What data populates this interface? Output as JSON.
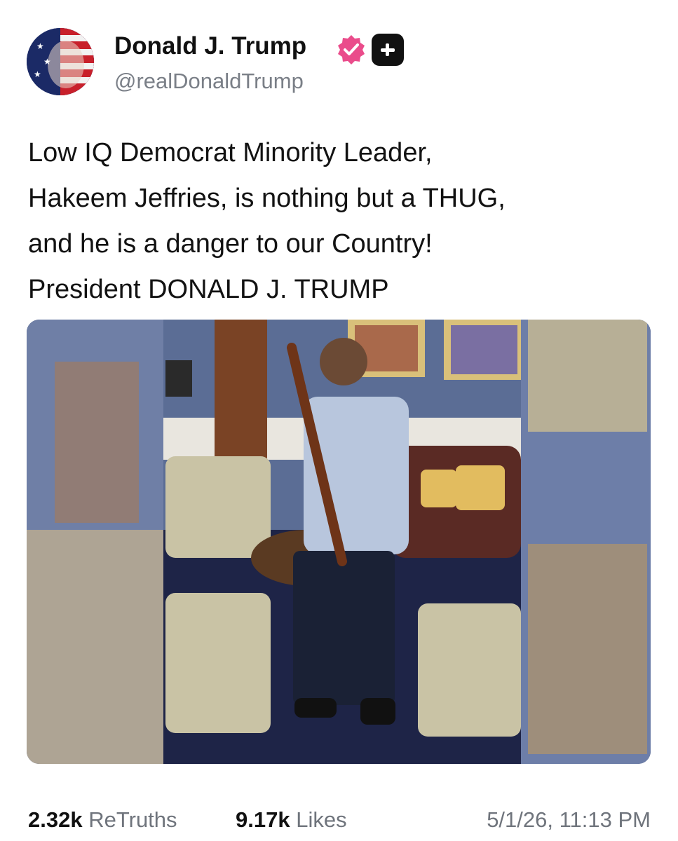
{
  "author": {
    "name": "Donald J. Trump",
    "handle": "@realDonaldTrump",
    "verified_color": "#ea4c8b"
  },
  "post": {
    "lines": [
      "Low IQ Democrat Minority Leader,",
      "Hakeem Jeffries, is nothing but a THUG,",
      "and he is a danger to our Country!",
      "President DONALD J. TRUMP"
    ]
  },
  "stats": {
    "retruths_count": "2.32k",
    "retruths_label": "ReTruths",
    "likes_count": "9.17k",
    "likes_label": "Likes",
    "timestamp": "5/1/26, 11:13 PM"
  },
  "icons": {
    "verified": "verified-badge-icon",
    "plus": "plus-badge-icon"
  }
}
